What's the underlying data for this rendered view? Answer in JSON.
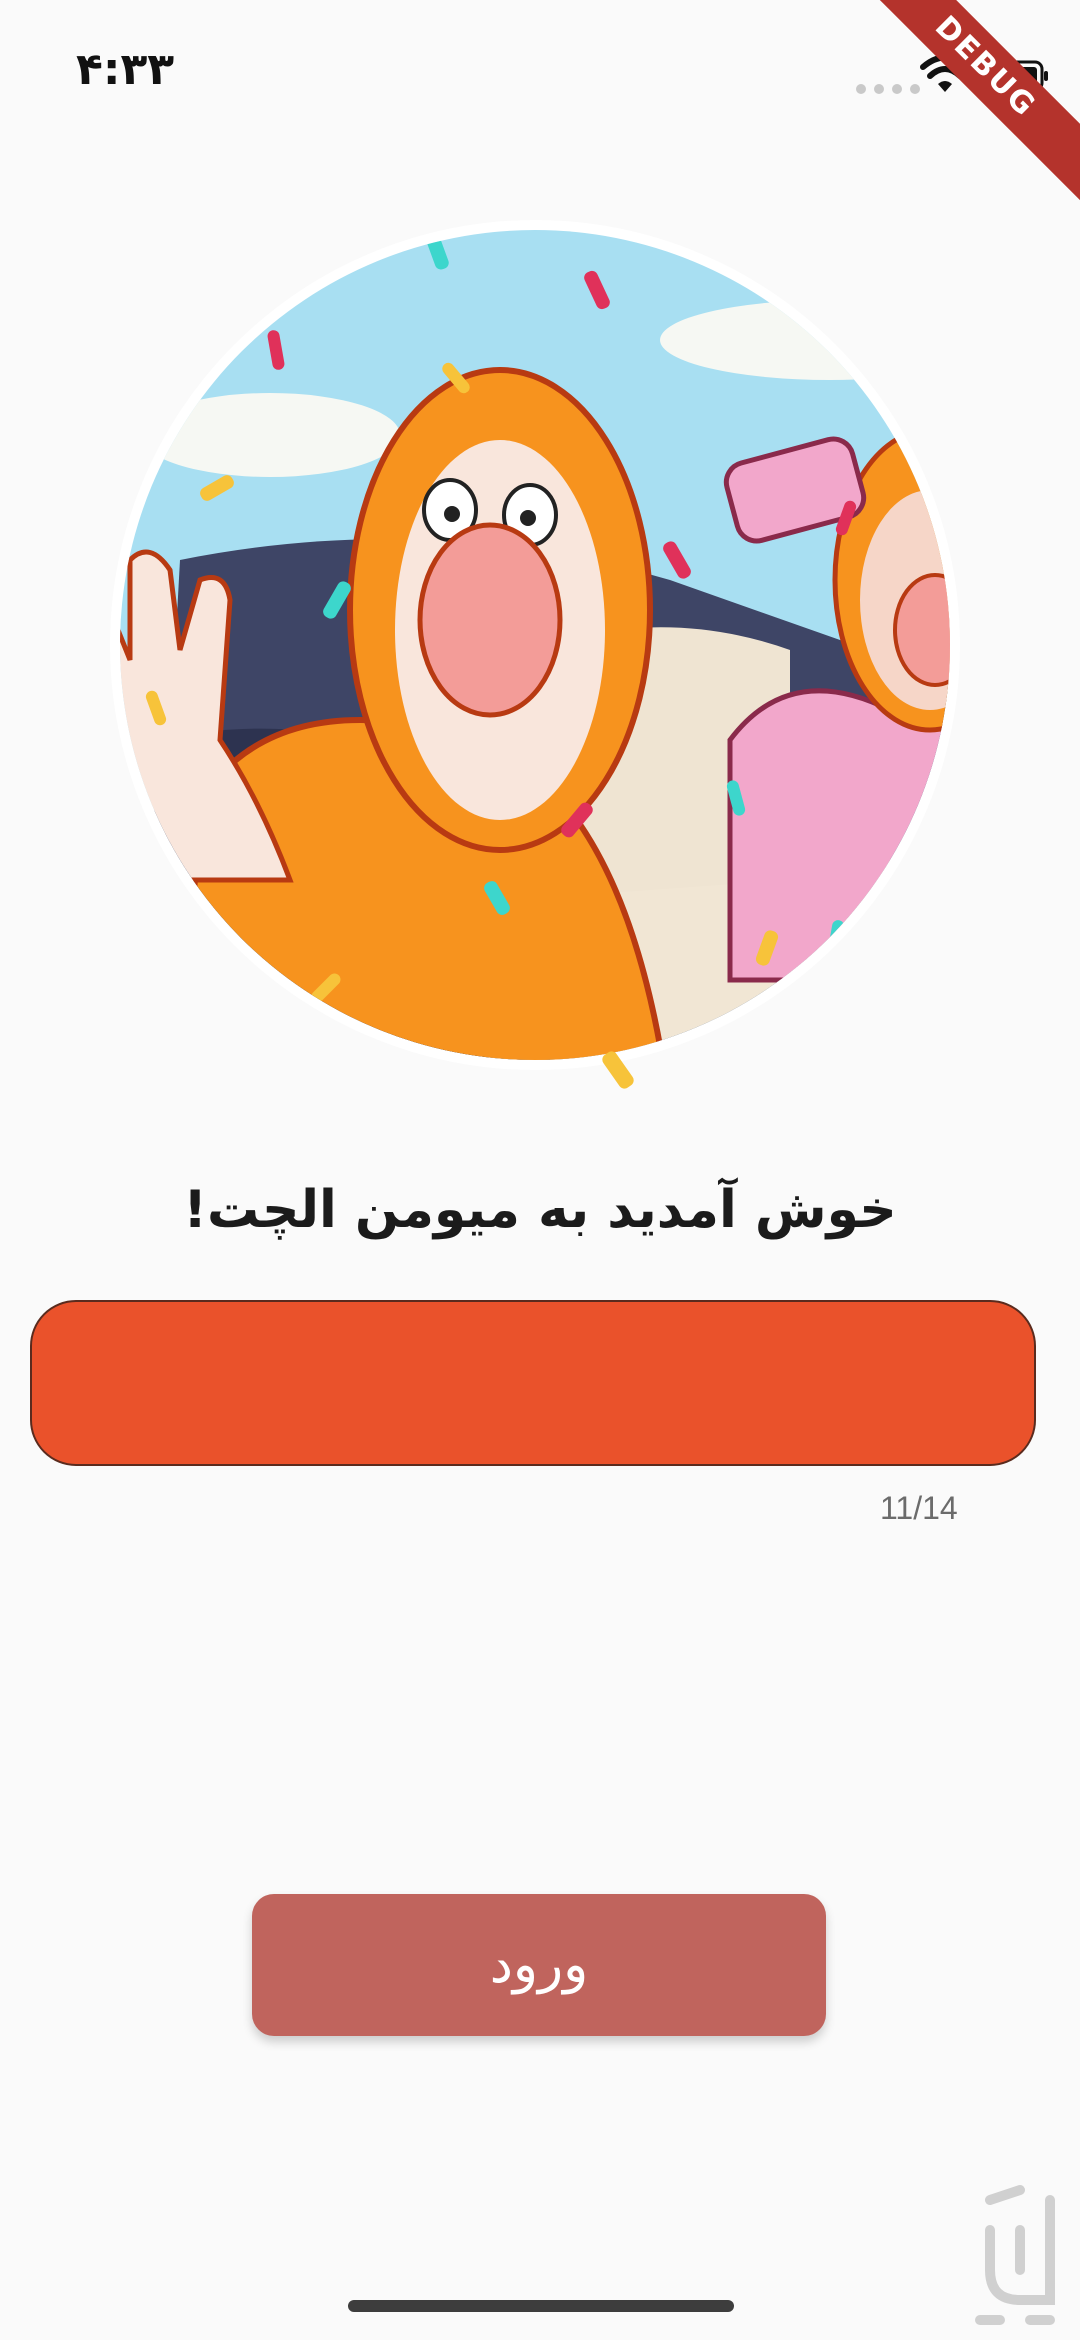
{
  "status_bar": {
    "time": "۴:۳۳"
  },
  "debug_banner": "DEBUG",
  "hero": {
    "icon": "celebration-illustration"
  },
  "welcome": {
    "title": "خوش آمدید به میومن الچت!"
  },
  "name_field": {
    "value": "",
    "counter": "11/14"
  },
  "login_button": {
    "label": "ورود"
  },
  "colors": {
    "field_fill": "#ea522b",
    "button_fill": "#c0645d",
    "background": "#fafafa"
  }
}
